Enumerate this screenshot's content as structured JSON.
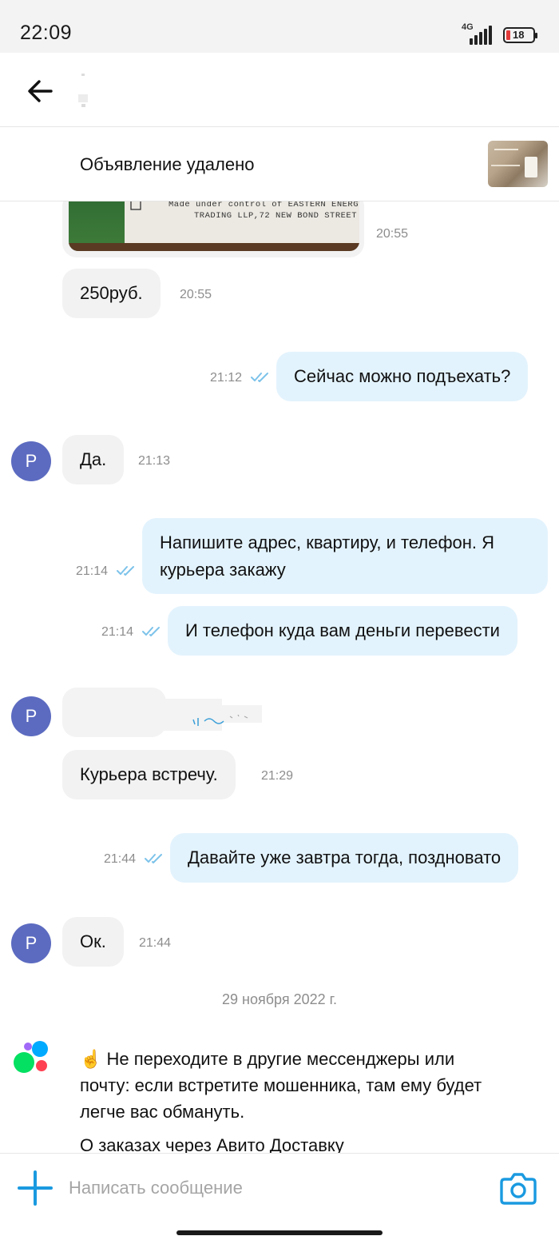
{
  "status_bar": {
    "time": "22:09",
    "network": "4G",
    "battery": "18",
    "battery_color": "#e23a3a"
  },
  "header": {
    "back_icon": "arrow-left-icon"
  },
  "ad_banner": {
    "text": "Объявление удалено"
  },
  "colors": {
    "incoming_bubble": "#f2f2f2",
    "outgoing_bubble": "#e3f3fd",
    "avatar": "#5c6bc0",
    "accent": "#1a9ae0",
    "read_checks": "#7dc3ea"
  },
  "photo": {
    "caption_line1": "Made under control of EASTERN ENERGY CO",
    "caption_line2": "TRADING LLP,72 NEW BOND STREET",
    "time": "20:55"
  },
  "messages": [
    {
      "id": "m1",
      "dir": "in",
      "text": "250руб.",
      "time": "20:55"
    },
    {
      "id": "m2",
      "dir": "out",
      "text": "Сейчас можно подъехать?",
      "time": "21:12"
    },
    {
      "id": "m3",
      "dir": "in",
      "avatar": "Р",
      "text": "Да.",
      "time": "21:13"
    },
    {
      "id": "m4",
      "dir": "out",
      "text": "Напишите адрес, квартиру, и телефон. Я курьера закажу",
      "time": "21:14"
    },
    {
      "id": "m5",
      "dir": "out",
      "text": "И телефон куда вам деньги перевести",
      "time": "21:14"
    },
    {
      "id": "m6",
      "dir": "in",
      "avatar": "Р",
      "text": "",
      "time": ""
    },
    {
      "id": "m7",
      "dir": "in",
      "text": "Курьера встречу.",
      "time": "21:29"
    },
    {
      "id": "m8",
      "dir": "out",
      "text": "Давайте уже завтра тогда, поздновато",
      "time": "21:44"
    },
    {
      "id": "m9",
      "dir": "in",
      "avatar": "Р",
      "text": "Ок.",
      "time": "21:44"
    }
  ],
  "date_separator": "29 ноября 2022 г.",
  "system_message": {
    "emoji": "☝️",
    "text": "Не переходите в другие мессенджеры или почту: если встретите мошенника, там ему будет легче вас обмануть.",
    "text2": "О заказах через Авито Доставку"
  },
  "input": {
    "placeholder": "Написать сообщение",
    "value": ""
  }
}
